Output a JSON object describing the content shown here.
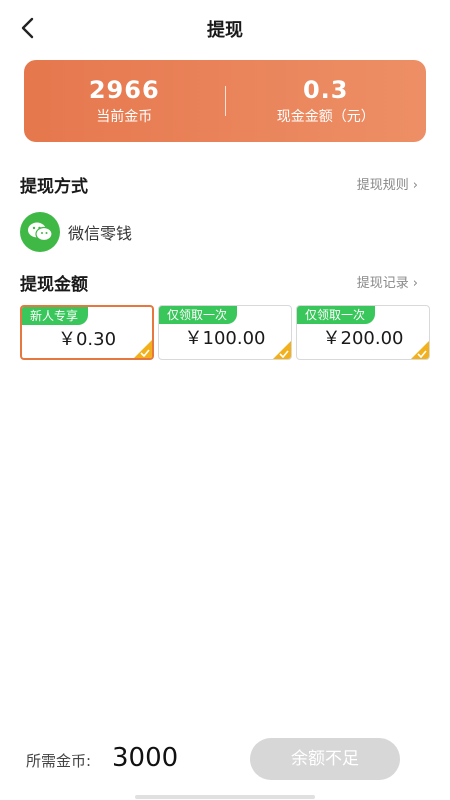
{
  "header": {
    "title": "提现"
  },
  "balance": {
    "coins_value": "2966",
    "coins_label": "当前金币",
    "cash_value": "0.3",
    "cash_label": "现金金额（元）"
  },
  "method_section": {
    "title": "提现方式",
    "link": "提现规则",
    "method_label": "微信零钱"
  },
  "amount_section": {
    "title": "提现金额",
    "link": "提现记录",
    "options": [
      {
        "tag": "新人专享",
        "value": "￥0.30",
        "selected": true
      },
      {
        "tag": "仅领取一次",
        "value": "￥100.00",
        "selected": false
      },
      {
        "tag": "仅领取一次",
        "value": "￥200.00",
        "selected": false
      }
    ]
  },
  "footer": {
    "required_label": "所需金币:",
    "required_value": "3000",
    "button_label": "余额不足"
  },
  "colors": {
    "accent": "#e6774d",
    "tag_green": "#39c65a",
    "wechat_green": "#3fb846",
    "corner_yellow": "#f2b11c",
    "button_disabled": "#d7d7d7"
  },
  "icons": [
    "back-arrow-icon",
    "wechat-icon",
    "chevron-right-icon",
    "check-icon"
  ]
}
